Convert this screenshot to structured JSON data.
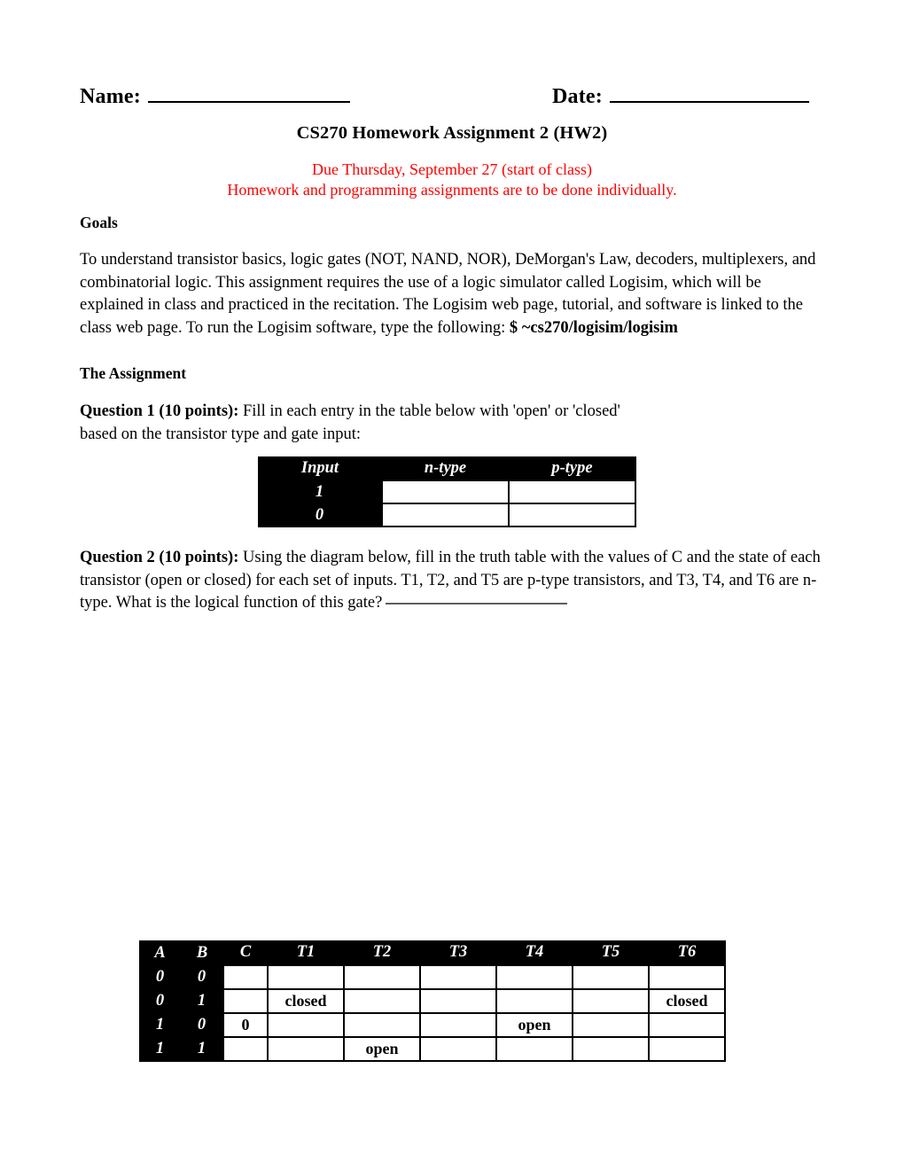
{
  "header": {
    "name_label": "Name:",
    "date_label": "Date:"
  },
  "title": "CS270 Homework Assignment 2 (HW2)",
  "due": {
    "line1": "Due Thursday, September 27 (start of class)",
    "line2": "Homework and programming assignments are to be done individually.",
    "color": "#ff0000"
  },
  "goals": {
    "heading": "Goals",
    "body": "To understand transistor basics, logic gates (NOT, NAND, NOR), DeMorgan's Law, decoders, multiplexers, and combinatorial logic. This assignment requires the use of a logic simulator called Logisim, which will be explained in class and practiced in the recitation. The Logisim web page, tutorial, and software is linked to the class web page. To run the Logisim software, type the following:",
    "command": "$ ~cs270/logisim/logisim"
  },
  "assignment": {
    "heading": "The Assignment"
  },
  "question1": {
    "label": "Question 1 (10 points):",
    "text_line1": " Fill in each entry in the table below with 'open' or 'closed'",
    "text_line2": " based on the transistor type and gate input:",
    "table": {
      "headers": [
        "Input",
        "n-type",
        "p-type"
      ],
      "rows": [
        {
          "label": "1",
          "n_type": "",
          "p_type": ""
        },
        {
          "label": "0",
          "n_type": "",
          "p_type": ""
        }
      ]
    }
  },
  "question2": {
    "label": "Question 2 (10 points):",
    "text": " Using the diagram below, fill in the truth table with the values of C and the state of each transistor (open or closed) for each set of inputs. T1, T2, and T5 are p-type transistors, and T3, T4, and T6 are n-type. What is the logical function of this gate?",
    "answer_blank": "",
    "table": {
      "headers": [
        "A",
        "B",
        "C",
        "T1",
        "T2",
        "T3",
        "T4",
        "T5",
        "T6"
      ],
      "rows": [
        {
          "A": "0",
          "B": "0",
          "C": "",
          "T1": "",
          "T2": "",
          "T3": "",
          "T4": "",
          "T5": "",
          "T6": ""
        },
        {
          "A": "0",
          "B": "1",
          "C": "",
          "T1": "closed",
          "T2": "",
          "T3": "",
          "T4": "",
          "T5": "",
          "T6": "closed"
        },
        {
          "A": "1",
          "B": "0",
          "C": "0",
          "T1": "",
          "T2": "",
          "T3": "",
          "T4": "open",
          "T5": "",
          "T6": ""
        },
        {
          "A": "1",
          "B": "1",
          "C": "",
          "T1": "",
          "T2": "open",
          "T3": "",
          "T4": "",
          "T5": "",
          "T6": ""
        }
      ]
    }
  }
}
